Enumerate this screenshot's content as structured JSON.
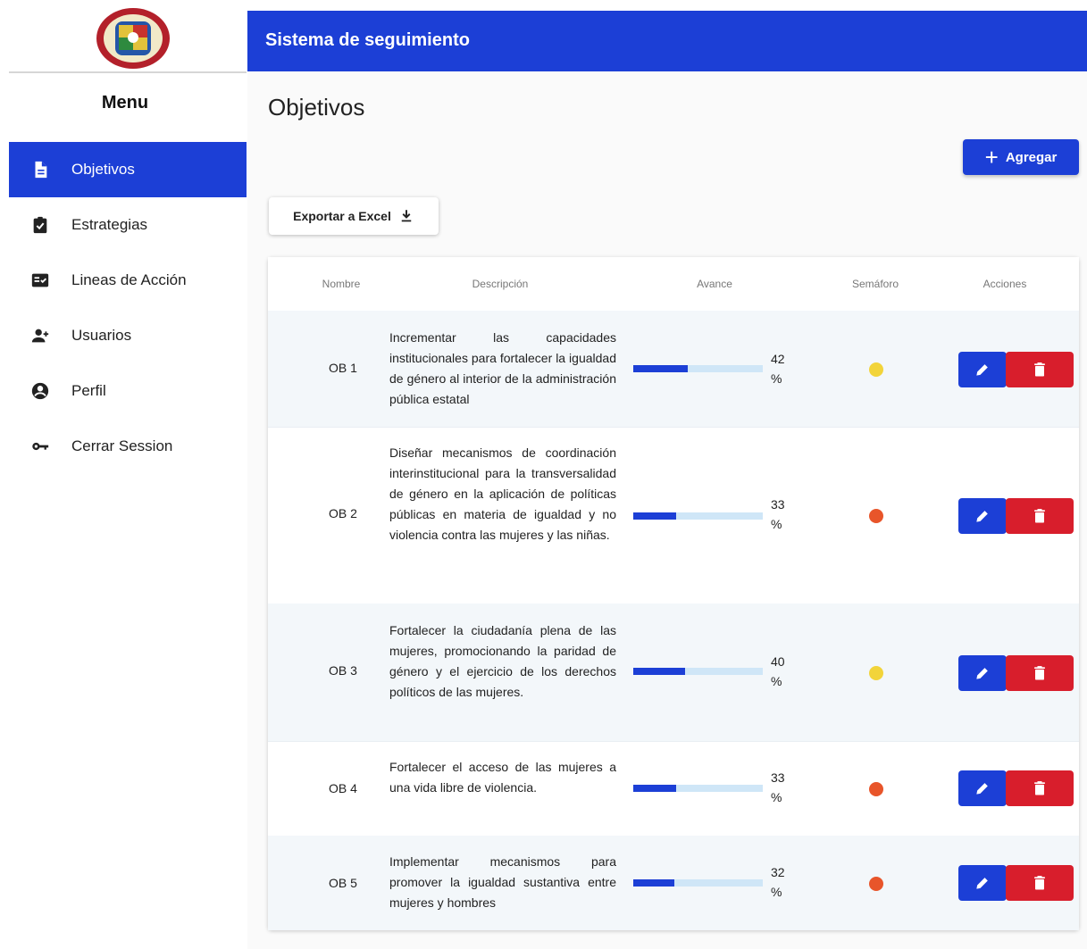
{
  "header": {
    "title": "Sistema de seguimiento"
  },
  "sidebar": {
    "menu_title": "Menu",
    "items": [
      {
        "label": "Objetivos",
        "icon": "document-icon",
        "active": true
      },
      {
        "label": "Estrategias",
        "icon": "clipboard-check-icon",
        "active": false
      },
      {
        "label": "Lineas de Acción",
        "icon": "list-check-icon",
        "active": false
      },
      {
        "label": "Usuarios",
        "icon": "user-add-icon",
        "active": false
      },
      {
        "label": "Perfil",
        "icon": "account-circle-icon",
        "active": false
      },
      {
        "label": "Cerrar Session",
        "icon": "key-icon",
        "active": false
      }
    ]
  },
  "main": {
    "title": "Objetivos",
    "add_button": "Agregar",
    "export_button": "Exportar a Excel"
  },
  "table": {
    "columns": [
      "Nombre",
      "Descripción",
      "Avance",
      "Semáforo",
      "Acciones"
    ],
    "rows": [
      {
        "name": "OB 1",
        "description": "Incrementar las capacidades institucionales para fortalecer la igualdad de género al interior de la administración pública estatal",
        "progress": 42,
        "progress_label": "42",
        "unit": "%",
        "semaforo": "yellow"
      },
      {
        "name": "OB 2",
        "description": "Diseñar mecanismos de coordinación interinstitucional para la transversalidad de género en la aplicación de políticas públicas en materia de igualdad y no violencia contra las mujeres y las niñas.",
        "progress": 33,
        "progress_label": "33",
        "unit": "%",
        "semaforo": "orange"
      },
      {
        "name": "OB 3",
        "description": "Fortalecer la ciudadanía plena de las mujeres, promocionando la paridad de género y el ejercicio de los derechos políticos de las mujeres.",
        "progress": 40,
        "progress_label": "40",
        "unit": "%",
        "semaforo": "yellow"
      },
      {
        "name": "OB 4",
        "description": "Fortalecer el acceso de las mujeres a una vida libre de violencia.",
        "progress": 33,
        "progress_label": "33",
        "unit": "%",
        "semaforo": "orange"
      },
      {
        "name": "OB 5",
        "description": "Implementar mecanismos para promover la igualdad sustantiva entre mujeres y hombres",
        "progress": 32,
        "progress_label": "32",
        "unit": "%",
        "semaforo": "orange"
      }
    ]
  },
  "colors": {
    "primary": "#1c3fd6",
    "danger": "#d81e2c",
    "progress_track": "#cfe6f7",
    "semaforo_yellow": "#f2d43a",
    "semaforo_orange": "#e8552a"
  }
}
